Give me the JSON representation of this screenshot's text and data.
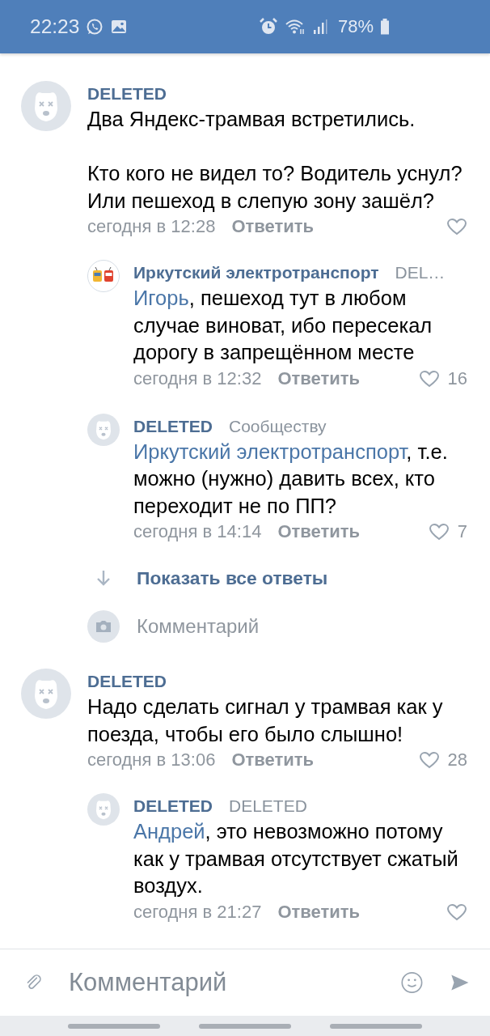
{
  "status_bar": {
    "time": "22:23",
    "battery": "78%"
  },
  "comments": [
    {
      "avatar": {
        "kind": "deleted"
      },
      "author": "DELETED",
      "text": "Два Яндекс-трамвая встретились.\n\nКто кого не видел то? Водитель уснул? Или пешеход в слепую зону зашёл?",
      "time": "сегодня в 12:28",
      "reply_label": "Ответить",
      "replies": [
        {
          "avatar": {
            "kind": "transport"
          },
          "author": "Иркутский электротранспорт",
          "to": "DEL…",
          "mention": "Игорь",
          "text": ", пешеход тут в любом случае виноват, ибо пересекал дорогу в запрещённом месте",
          "time": "сегодня в 12:32",
          "reply_label": "Ответить",
          "likes": "16"
        },
        {
          "avatar": {
            "kind": "deleted"
          },
          "author": "DELETED",
          "to": "Сообществу",
          "mention": "Иркутский электротранспорт",
          "text": ", т.е. можно (нужно) давить всех, кто переходит не по ПП?",
          "time": "сегодня в 14:14",
          "reply_label": "Ответить",
          "likes": "7"
        }
      ],
      "show_all": "Показать все ответы",
      "comment_prompt": "Комментарий"
    },
    {
      "avatar": {
        "kind": "deleted"
      },
      "author": "DELETED",
      "text": "Надо сделать сигнал у трамвая как у поезда, чтобы его было слышно!",
      "time": "сегодня в 13:06",
      "reply_label": "Ответить",
      "likes": "28",
      "replies": [
        {
          "avatar": {
            "kind": "deleted"
          },
          "author": "DELETED",
          "to": "DELETED",
          "mention": "Андрей",
          "text": ", это невозможно потому как у трамвая отсутствует сжатый воздух.",
          "time": "сегодня в 21:27",
          "reply_label": "Ответить"
        }
      ]
    }
  ],
  "input_bar": {
    "placeholder": "Комментарий"
  }
}
